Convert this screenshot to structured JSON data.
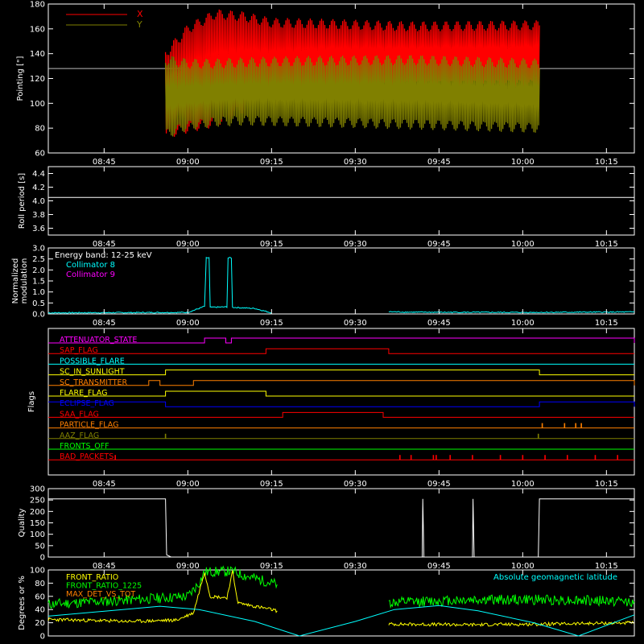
{
  "chart_data": [
    {
      "panel": "pointing",
      "type": "line",
      "ylabel": "Pointing [\"]",
      "ylim": [
        60,
        180
      ],
      "yticks": [
        60,
        80,
        100,
        120,
        140,
        160,
        180
      ],
      "x_range": [
        "08:35",
        "10:20"
      ],
      "x_ticks": [
        "08:45",
        "09:00",
        "09:15",
        "09:30",
        "09:45",
        "10:00",
        "10:15"
      ],
      "reference_line": 128,
      "legend": [
        {
          "name": "X",
          "color": "#ff0000"
        },
        {
          "name": "Y",
          "color": "#808000"
        }
      ],
      "series": [
        {
          "name": "X",
          "color": "#ff0000",
          "envelope": [
            {
              "t": "08:56",
              "lo": 75,
              "hi": 140
            },
            {
              "t": "09:00",
              "lo": 80,
              "hi": 160
            },
            {
              "t": "09:05",
              "lo": 85,
              "hi": 172
            },
            {
              "t": "09:10",
              "lo": 96,
              "hi": 170
            },
            {
              "t": "09:15",
              "lo": 102,
              "hi": 165
            },
            {
              "t": "09:25",
              "lo": 110,
              "hi": 164
            },
            {
              "t": "09:40",
              "lo": 114,
              "hi": 162
            },
            {
              "t": "10:03",
              "lo": 115,
              "hi": 163
            }
          ]
        },
        {
          "name": "Y",
          "color": "#808000",
          "envelope": [
            {
              "t": "08:56",
              "lo": 75,
              "hi": 135
            },
            {
              "t": "09:00",
              "lo": 82,
              "hi": 132
            },
            {
              "t": "09:05",
              "lo": 85,
              "hi": 132
            },
            {
              "t": "09:10",
              "lo": 86,
              "hi": 133
            },
            {
              "t": "09:20",
              "lo": 85,
              "hi": 134
            },
            {
              "t": "09:40",
              "lo": 83,
              "hi": 135
            },
            {
              "t": "10:03",
              "lo": 80,
              "hi": 132
            }
          ]
        }
      ]
    },
    {
      "panel": "roll",
      "type": "line",
      "ylabel": "Roll period [s]",
      "ylim": [
        3.5,
        4.5
      ],
      "yticks": [
        3.6,
        3.8,
        4.0,
        4.2,
        4.4
      ],
      "x_range": [
        "08:35",
        "10:20"
      ],
      "x_ticks": [
        "08:45",
        "09:00",
        "09:15",
        "09:30",
        "09:45",
        "10:00",
        "10:15"
      ],
      "series": [
        {
          "name": "roll",
          "color": "#ffffff",
          "value": 4.05
        }
      ]
    },
    {
      "panel": "modulation",
      "type": "line",
      "ylabel": [
        "Normalized",
        "modulation"
      ],
      "ylim": [
        0,
        3.0
      ],
      "yticks": [
        0.0,
        0.5,
        1.0,
        1.5,
        2.0,
        2.5,
        3.0
      ],
      "x_range": [
        "08:35",
        "10:20"
      ],
      "x_ticks": [
        "08:45",
        "09:00",
        "09:15",
        "09:30",
        "09:45",
        "10:00",
        "10:15"
      ],
      "legend_title": "Energy band: 12-25 keV",
      "legend": [
        {
          "name": "Collimator 8",
          "color": "#00ffff"
        },
        {
          "name": "Collimator 9",
          "color": "#ff00ff"
        }
      ],
      "series": [
        {
          "name": "Collimator 8",
          "color": "#00ffff",
          "segments": [
            [
              [
                "08:35",
                0.05
              ],
              [
                "09:00",
                0.07
              ],
              [
                "09:02",
                0.25
              ],
              [
                "09:03",
                0.35
              ],
              [
                "09:03.3",
                2.55
              ],
              [
                "09:03.8",
                2.55
              ],
              [
                "09:04",
                0.3
              ],
              [
                "09:07",
                0.32
              ],
              [
                "09:07.2",
                2.55
              ],
              [
                "09:07.8",
                2.55
              ],
              [
                "09:08",
                0.3
              ],
              [
                "09:12",
                0.25
              ],
              [
                "09:15",
                0.05
              ]
            ],
            [
              [
                "09:36",
                0.1
              ],
              [
                "09:40",
                0.08
              ],
              [
                "10:00",
                0.07
              ],
              [
                "10:20",
                0.09
              ]
            ]
          ]
        }
      ]
    },
    {
      "panel": "flags",
      "type": "line",
      "ylabel": "Flags",
      "x_range": [
        "08:35",
        "10:20"
      ],
      "x_ticks": [
        "08:45",
        "09:00",
        "09:15",
        "09:30",
        "09:45",
        "10:00",
        "10:15"
      ],
      "flags": [
        {
          "name": "ATTENUATOR_STATE",
          "color": "#ff00ff",
          "on": [
            [
              "09:03",
              "09:06.8"
            ],
            [
              "09:07.8",
              "10:20"
            ]
          ]
        },
        {
          "name": "SAP_FLAG",
          "color": "#ff0000",
          "on": [
            [
              "09:14",
              "09:36"
            ]
          ]
        },
        {
          "name": "POSSIBLE_FLARE",
          "color": "#00ffff",
          "on": []
        },
        {
          "name": "SC_IN_SUNLIGHT",
          "color": "#ffff00",
          "on": [
            [
              "08:56",
              "10:03"
            ]
          ]
        },
        {
          "name": "SC_TRANSMITTER",
          "color": "#ff8000",
          "on": [
            [
              "08:53",
              "08:55"
            ],
            [
              "09:01",
              "10:20"
            ]
          ]
        },
        {
          "name": "FLARE_FLAG",
          "color": "#ffff00",
          "on": [
            [
              "08:56",
              "09:14"
            ]
          ]
        },
        {
          "name": "ECLIPSE_FLAG",
          "color": "#0000ff",
          "on": [
            [
              "08:35",
              "08:56"
            ],
            [
              "10:03",
              "10:20"
            ]
          ]
        },
        {
          "name": "SAA_FLAG",
          "color": "#ff0000",
          "on": [
            [
              "09:17",
              "09:35"
            ]
          ]
        },
        {
          "name": "PARTICLE_FLAG",
          "color": "#ff8000",
          "spikes": [
            "10:03.5",
            "10:07.5",
            "10:09.5",
            "10:10.5"
          ]
        },
        {
          "name": "AAZ_FLAG",
          "color": "#808000",
          "spikes": [
            "08:56",
            "10:02.8"
          ]
        },
        {
          "name": "FRONTS_OFF",
          "color": "#00ff00",
          "on": []
        },
        {
          "name": "BAD_PACKETS",
          "color": "#ff0000",
          "spikes": [
            "08:47",
            "09:38",
            "09:40",
            "09:44",
            "09:44.5",
            "09:47",
            "09:51",
            "09:56",
            "10:00",
            "10:04",
            "10:08",
            "10:13",
            "10:17"
          ]
        }
      ]
    },
    {
      "panel": "quality",
      "type": "line",
      "ylabel": "Quality",
      "ylim": [
        0,
        300
      ],
      "yticks": [
        0,
        50,
        100,
        150,
        200,
        250,
        300
      ],
      "x_range": [
        "08:35",
        "10:20"
      ],
      "x_ticks": [
        "08:45",
        "09:00",
        "09:15",
        "09:30",
        "09:45",
        "10:00",
        "10:15"
      ],
      "series": [
        {
          "name": "quality",
          "color": "#ffffff",
          "points": [
            [
              "08:35",
              255
            ],
            [
              "08:56",
              255
            ],
            [
              "08:56.2",
              10
            ],
            [
              "08:57",
              0
            ],
            [
              "09:42",
              0
            ],
            [
              "09:42.1",
              255
            ],
            [
              "09:42.3",
              0
            ],
            [
              "09:51",
              0
            ],
            [
              "09:51.1",
              255
            ],
            [
              "09:51.3",
              0
            ],
            [
              "10:02.8",
              0
            ],
            [
              "10:03",
              255
            ],
            [
              "10:20",
              255
            ]
          ]
        }
      ]
    },
    {
      "panel": "ratios",
      "type": "line",
      "ylabel": "Degrees or %",
      "ylim": [
        0,
        100
      ],
      "yticks": [
        0,
        20,
        40,
        60,
        80,
        100
      ],
      "x_range": [
        "08:35",
        "10:20"
      ],
      "x_ticks": [
        "08:45",
        "09:00",
        "09:15",
        "09:30",
        "09:45",
        "10:00",
        "10:15"
      ],
      "legend": [
        {
          "name": "FRONT_RATIO",
          "color": "#ffff00"
        },
        {
          "name": "FRONT_RATIO_1225",
          "color": "#00ff00"
        },
        {
          "name": "MAX_DET_VS_TOT",
          "color": "#ff8000"
        }
      ],
      "right_legend": {
        "name": "Absolute geomagnetic latitude",
        "color": "#00ffff"
      },
      "series": [
        {
          "name": "FRONT_RATIO",
          "color": "#ffff00",
          "segments": [
            [
              [
                "08:35",
                25
              ],
              [
                "08:50",
                22
              ],
              [
                "08:58",
                24
              ],
              [
                "09:01",
                35
              ],
              [
                "09:03",
                97
              ],
              [
                "09:04",
                60
              ],
              [
                "09:07",
                58
              ],
              [
                "09:08",
                97
              ],
              [
                "09:09",
                50
              ],
              [
                "09:12",
                45
              ],
              [
                "09:15",
                40
              ],
              [
                "09:16",
                38
              ]
            ],
            [
              [
                "09:36",
                18
              ],
              [
                "09:50",
                17
              ],
              [
                "10:05",
                18
              ],
              [
                "10:20",
                20
              ]
            ]
          ]
        },
        {
          "name": "FRONT_RATIO_1225",
          "color": "#00ff00",
          "segments": [
            [
              [
                "08:35",
                48
              ],
              [
                "08:50",
                55
              ],
              [
                "09:00",
                60
              ],
              [
                "09:02",
                80
              ],
              [
                "09:03",
                97
              ],
              [
                "09:08",
                98
              ],
              [
                "09:10",
                92
              ],
              [
                "09:13",
                85
              ],
              [
                "09:16",
                78
              ]
            ],
            [
              [
                "09:36",
                50
              ],
              [
                "09:50",
                55
              ],
              [
                "10:05",
                55
              ],
              [
                "10:20",
                52
              ]
            ]
          ]
        },
        {
          "name": "Absolute geomagnetic latitude",
          "color": "#00ffff",
          "points": [
            [
              "08:35",
              30
            ],
            [
              "08:55",
              45
            ],
            [
              "09:02",
              40
            ],
            [
              "09:12",
              22
            ],
            [
              "09:20",
              0
            ],
            [
              "09:30",
              22
            ],
            [
              "09:37",
              40
            ],
            [
              "09:45",
              46
            ],
            [
              "09:52",
              38
            ],
            [
              "10:02",
              20
            ],
            [
              "10:10",
              0
            ],
            [
              "10:20",
              32
            ]
          ]
        }
      ]
    }
  ]
}
